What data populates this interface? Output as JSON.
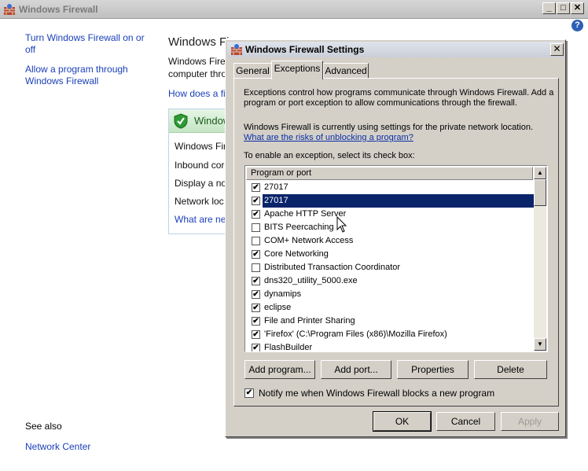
{
  "main_window": {
    "title": "Windows Firewall",
    "controls": {
      "minimize": "_",
      "maximize": "□",
      "close": "✕"
    },
    "help_label": "?"
  },
  "left_pane": {
    "links": [
      "Turn Windows Firewall on or off",
      "Allow a program through Windows Firewall"
    ],
    "see_also_heading": "See also",
    "see_also_link": "Network Center"
  },
  "background": {
    "heading": "Windows Fi",
    "intro_line1": "Windows Fire",
    "intro_line2": "computer thro",
    "how_link": "How does a fi",
    "status_title": "Window",
    "items": [
      "Windows Fir",
      "Inbound cor",
      "Display a no",
      "Network loc"
    ],
    "whats_link": "What are ne"
  },
  "dialog": {
    "title": "Windows Firewall Settings",
    "close_label": "✕",
    "tabs": [
      {
        "label": "General",
        "active": false
      },
      {
        "label": "Exceptions",
        "active": true
      },
      {
        "label": "Advanced",
        "active": false
      }
    ],
    "intro_text": "Exceptions control how programs communicate through Windows Firewall. Add a program or port exception to allow communications through the firewall.",
    "location_text": "Windows Firewall is currently using settings for the private network location.",
    "risks_link": "What are the risks of unblocking a program?",
    "instruction": "To enable an exception, select its check box:",
    "list_header": "Program or port",
    "items": [
      {
        "label": "27017",
        "checked": true,
        "selected": false
      },
      {
        "label": "27017",
        "checked": true,
        "selected": true
      },
      {
        "label": "Apache HTTP Server",
        "checked": true,
        "selected": false
      },
      {
        "label": "BITS Peercaching",
        "checked": false,
        "selected": false
      },
      {
        "label": "COM+ Network Access",
        "checked": false,
        "selected": false
      },
      {
        "label": "Core Networking",
        "checked": true,
        "selected": false
      },
      {
        "label": "Distributed Transaction Coordinator",
        "checked": false,
        "selected": false
      },
      {
        "label": "dns320_utility_5000.exe",
        "checked": true,
        "selected": false
      },
      {
        "label": "dynamips",
        "checked": true,
        "selected": false
      },
      {
        "label": "eclipse",
        "checked": true,
        "selected": false
      },
      {
        "label": "File and Printer Sharing",
        "checked": true,
        "selected": false
      },
      {
        "label": "'Firefox' (C:\\Program Files (x86)\\Mozilla Firefox)",
        "checked": true,
        "selected": false
      },
      {
        "label": "FlashBuilder",
        "checked": true,
        "selected": false
      }
    ],
    "buttons": {
      "add_program": "Add program...",
      "add_port": "Add port...",
      "properties": "Properties",
      "delete": "Delete"
    },
    "notify_checked": true,
    "notify_label": "Notify me when Windows Firewall blocks a new program",
    "footer": {
      "ok": "OK",
      "cancel": "Cancel",
      "apply": "Apply"
    }
  },
  "colors": {
    "link": "#1a3fb8",
    "selection": "#0a246a",
    "dialog_face": "#d4d0c8"
  },
  "icons": [
    "firewall-icon",
    "shield-check-icon",
    "mouse-cursor-icon",
    "scroll-up-arrow-icon",
    "scroll-down-arrow-icon"
  ]
}
